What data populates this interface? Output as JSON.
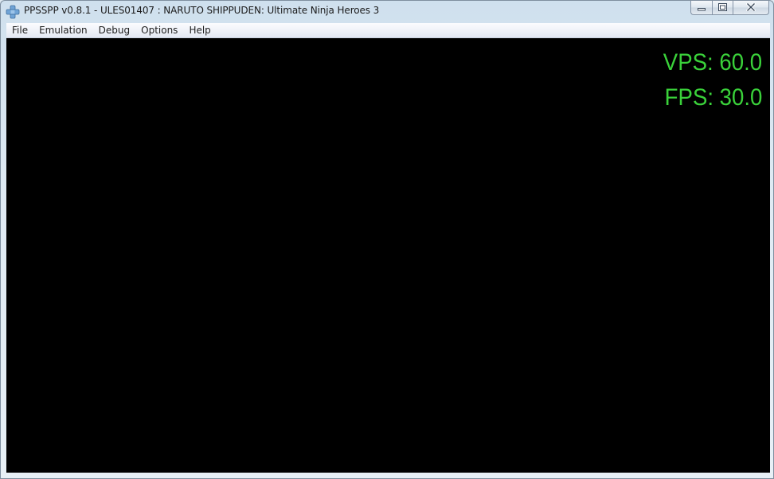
{
  "window": {
    "title": "PPSSPP v0.8.1 - ULES01407 : NARUTO SHIPPUDEN: Ultimate Ninja Heroes 3",
    "icon": "ppsspp-logo-icon"
  },
  "caption_buttons": {
    "minimize_icon": "minimize-icon",
    "maximize_icon": "restore-icon",
    "close_icon": "close-icon"
  },
  "menu": {
    "items": [
      {
        "label": "File"
      },
      {
        "label": "Emulation"
      },
      {
        "label": "Debug"
      },
      {
        "label": "Options"
      },
      {
        "label": "Help"
      }
    ]
  },
  "overlay": {
    "vps": "VPS: 60.0",
    "fps": "FPS: 30.0",
    "color": "#3ad13a"
  },
  "colors": {
    "screen_background": "#000000",
    "accent": "#3ad13a"
  }
}
